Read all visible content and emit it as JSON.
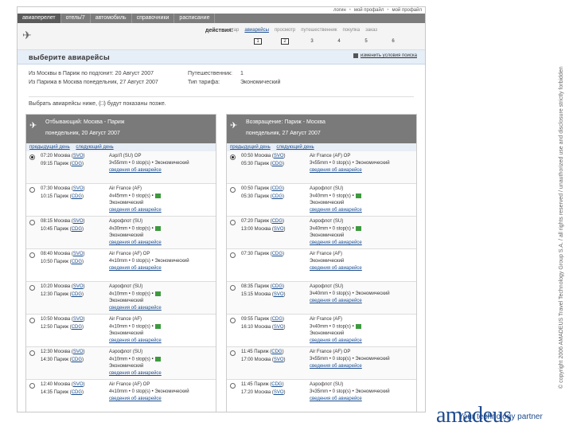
{
  "header": {
    "top_links": [
      "логин",
      "мой профайл",
      "мой профайл"
    ],
    "nav_tabs": [
      "авиаперелет",
      "отель/7",
      "автомобиль",
      "справочники",
      "расписание"
    ],
    "actions_label": "действия:",
    "steps": [
      "стар",
      "авиарейсы",
      "просмотр",
      "путешественник",
      "покупка",
      "заказ"
    ],
    "step_numbers": [
      "1",
      "2",
      "3",
      "4",
      "5",
      "6"
    ]
  },
  "title_bar": {
    "title": "выберите авиарейсы",
    "change_button": "изменить условия поиска"
  },
  "summary": {
    "outbound": "Из Москвы в Париж  по подгонит: 20 Август 2007",
    "return": "Из Парижа в Москва  понедельник, 27 Август 2007",
    "travellers_label": "Путешественник:",
    "travellers_value": "1",
    "fare_label": "Тип тарифа:",
    "fare_value": "Экономический"
  },
  "hint": "Выбрать авиарейсы ниже, (□) будут показаны позже.",
  "outbound_panel": {
    "icon": "plane-icon",
    "title": "Отбывающий: Москва - Париж",
    "date": "понедельник, 20 Август 2007",
    "prev_day": "предыдущий день",
    "next_day": "следующий день",
    "flights": [
      {
        "dep": "07:20  Москва (SVO)",
        "arr": "09:15  Париж (CDG)",
        "l1": "Аэр/Л (SU) OP",
        "l2": "3ч55mm • 0 stop(s) • Экономический",
        "l3": "сведения об авиарейсе",
        "l4": "",
        "selected": true
      },
      {
        "dep": "07:30  Москва (SVO)",
        "arr": "10:15  Париж (CDG)",
        "l1": "Air France (AF)",
        "l2": "4ч45mm • 0 stop(s) •",
        "l3": "Экономический",
        "l4": "сведения об авиарейсе",
        "selected": false
      },
      {
        "dep": "08:15  Москва (SVO)",
        "arr": "10:45  Париж (CDG)",
        "l1": "Аэрофлот (SU)",
        "l2": "4ч30mm • 0 stop(s) •",
        "l3": "Экономический",
        "l4": "сведения об авиарейсе",
        "selected": false
      },
      {
        "dep": "08:40  Москва (SVO)",
        "arr": "10:50  Париж (CDG)",
        "l1": "Air France (AF) OP",
        "l2": "4ч10mm • 0 stop(s) • Экономический",
        "l3": "сведения об авиарейсе",
        "l4": "",
        "selected": false
      },
      {
        "dep": "10:20  Москва (SVO)",
        "arr": "12:30  Париж (CDG)",
        "l1": "Аэрофлот (SU)",
        "l2": "4ч10mm • 0 stop(s) •",
        "l3": "Экономический",
        "l4": "сведения об авиарейсе",
        "selected": false
      },
      {
        "dep": "10:50  Москва (SVO)",
        "arr": "12:50  Париж (CDG)",
        "l1": "Air France (AF)",
        "l2": "4ч10mm • 0 stop(s) •",
        "l3": "Экономический",
        "l4": "сведения об авиарейсе",
        "selected": false
      },
      {
        "dep": "12:30  Москва (SVO)",
        "arr": "14:30  Париж (CDG)",
        "l1": "Аэрофлот (SU)",
        "l2": "4ч10mm • 0 stop(s) •",
        "l3": "Экономический",
        "l4": "сведения об авиарейсе",
        "selected": false
      },
      {
        "dep": "12:40  Москва (SVO)",
        "arr": "14:35  Париж (CDG)",
        "l1": "Air France (AF) OP",
        "l2": "4ч10mm • 0 stop(s) • Экономический",
        "l3": "сведения об авиарейсе",
        "l4": "",
        "selected": false
      }
    ]
  },
  "return_panel": {
    "icon": "plane-icon",
    "title": "Возвращение: Париж - Москва",
    "date": "понедельник, 27 Август 2007",
    "prev_day": "предыдущий день",
    "next_day": "следующий день",
    "flights": [
      {
        "dep": "00:50  Москва (SVO)",
        "arr": "05:30  Париж (CDG)",
        "l1": "Air France (AF) OP",
        "l2": "3ч55mm • 0 stop(s) • Экономический",
        "l3": "сведения об авиарейсе",
        "l4": "",
        "selected": true
      },
      {
        "dep": "00:50  Париж (CDG)",
        "arr": "05:30  Париж (CDG)",
        "l1": "Аэрофлот (SU)",
        "l2": "3ч40mm • 0 stop(s) •",
        "l3": "Экономический",
        "l4": "сведения об авиарейсе",
        "selected": false
      },
      {
        "dep": "07:20  Париж (CDG)",
        "arr": "13:00  Москва (SVO)",
        "l1": "Аэрофлот (SU)",
        "l2": "3ч40mm • 0 stop(s) •",
        "l3": "Экономический",
        "l4": "сведения об авиарейсе",
        "selected": false
      },
      {
        "dep": "07:30  Париж (CDG)",
        "arr": "",
        "l1": "Air France (AF)",
        "l2": "Экономический",
        "l3": "сведения об авиарейсе",
        "l4": "",
        "selected": false
      },
      {
        "dep": "08:35  Париж (CDG)",
        "arr": "15:15  Москва (SVO)",
        "l1": "Аэрофлот (SU)",
        "l2": "3ч40mm • 0 stop(s) • Экономический",
        "l3": "сведения об авиарейсе",
        "l4": "",
        "selected": false
      },
      {
        "dep": "09:55  Париж (CDG)",
        "arr": "16:10  Москва (SVO)",
        "l1": "Air France (AF)",
        "l2": "3ч40mm • 0 stop(s) •",
        "l3": "Экономический",
        "l4": "сведения об авиарейсе",
        "selected": false
      },
      {
        "dep": "11:45  Париж (CDG)",
        "arr": "17:00  Москва (SVO)",
        "l1": "Air France (AF) OP",
        "l2": "3ч55mm • 0 stop(s) • Экономический",
        "l3": "сведения об авиарейсе",
        "l4": "",
        "selected": false
      },
      {
        "dep": "11:45  Париж (CDG)",
        "arr": "17:20  Москва (SVO)",
        "l1": "Аэрофлот (SU)",
        "l2": "3ч35mm • 0 stop(s) • Экономический",
        "l3": "сведения об авиарейсе",
        "l4": "",
        "selected": false
      }
    ]
  },
  "copyright": "© copyright 2006 AMADEUS Travel Technology Group S.A. / all rights reserved / unauthorized use and disclosure strictly forbidden",
  "brand": {
    "logo": "amadeus",
    "tagline": "Your technology partner",
    "color": "#1e4b8f"
  }
}
